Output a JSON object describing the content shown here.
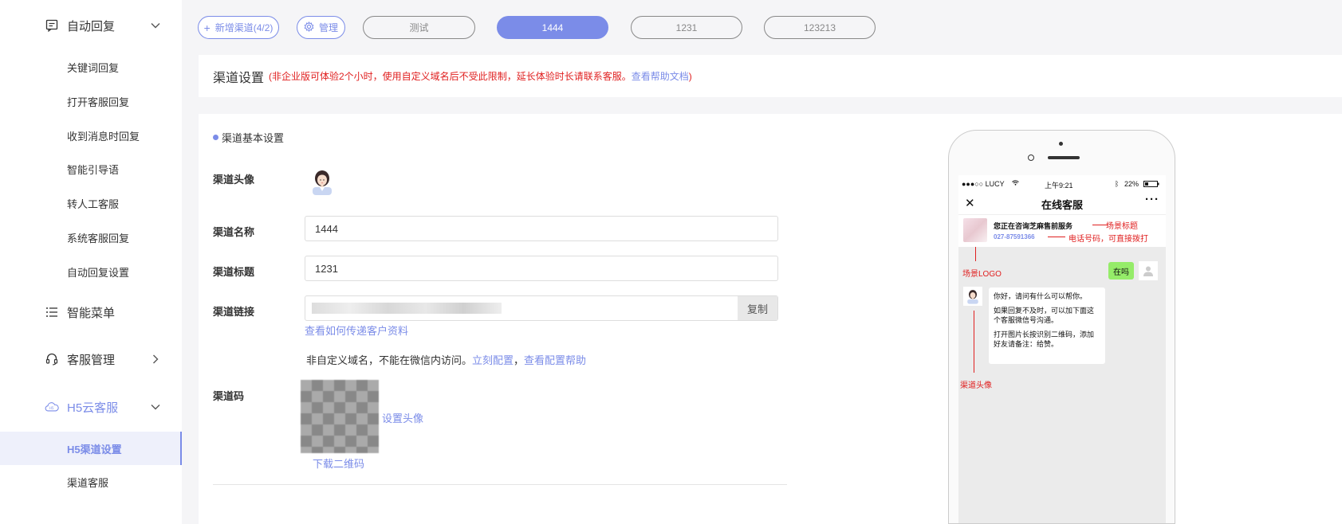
{
  "sidebar": {
    "groups": [
      {
        "label": "自动回复",
        "icon": "message-icon",
        "chevron": "down"
      },
      {
        "label": "智能菜单",
        "icon": "list-icon",
        "chevron": ""
      },
      {
        "label": "客服管理",
        "icon": "headset-icon",
        "chevron": "right"
      },
      {
        "label": "H5云客服",
        "icon": "cloud-icon",
        "chevron": "down"
      }
    ],
    "auto_reply_items": [
      "关键词回复",
      "打开客服回复",
      "收到消息时回复",
      "智能引导语",
      "转人工客服",
      "系统客服回复",
      "自动回复设置"
    ],
    "h5_items": [
      "H5渠道设置",
      "渠道客服"
    ]
  },
  "topbar": {
    "add_channel": "新增渠道(4/2)",
    "manage": "管理",
    "tabs": [
      "测试",
      "1444",
      "1231",
      "123213"
    ],
    "active_tab": "1444"
  },
  "channel_settings": {
    "title": "渠道设置",
    "note_prefix": "(非企业版可体验2个小时，使用自定义域名后不受此限制，延长体验时长请联系客服。",
    "note_link": "查看帮助文档",
    "note_suffix": ")"
  },
  "basic": {
    "section_title": "渠道基本设置",
    "avatar_label": "渠道头像",
    "name_label": "渠道名称",
    "name_value": "1444",
    "title_label": "渠道标题",
    "title_value": "1231",
    "link_label": "渠道链接",
    "copy_button": "复制",
    "pass_info_link": "查看如何传递客户资料",
    "domain_note": "非自定义域名，不能在微信内访问。",
    "configure_now": "立刻配置",
    "comma": "，",
    "config_help": "查看配置帮助",
    "code_label": "渠道码",
    "set_avatar": "设置头像",
    "download_qr": "下载二维码"
  },
  "preview": {
    "carrier": "●●●○○ LUCY",
    "time": "上午9:21",
    "battery": "22%",
    "nav_title": "在线客服",
    "scene_title": "您正在咨询芝麻售前服务",
    "phone": "027-87591366",
    "ann_scene_title": "场景标题",
    "ann_phone": "电话号码，可直接拨打",
    "ann_logo": "场景LOGO",
    "ann_avatar": "渠道头像",
    "user_msg": "在吗",
    "bot_msg_1": "你好，请问有什么可以帮你。",
    "bot_msg_2": "如果回复不及时，可以加下面这个客服微信号沟通。",
    "bot_msg_3": "打开图片长按识别二维码，添加好友请备注：给赞。"
  },
  "colors": {
    "accent": "#7b8ce8",
    "warning": "#e02020"
  }
}
